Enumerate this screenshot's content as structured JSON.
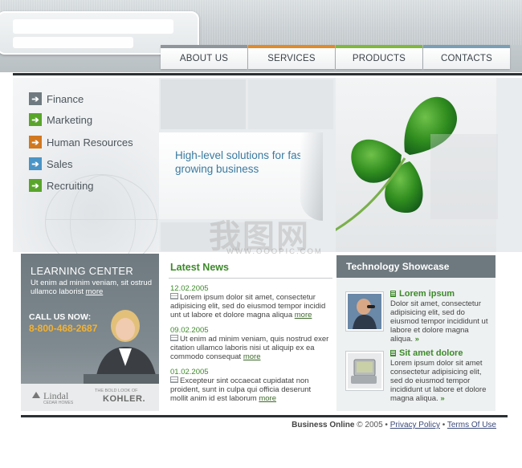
{
  "nav": {
    "tabs": [
      {
        "label": "ABOUT US"
      },
      {
        "label": "SERVICES"
      },
      {
        "label": "PRODUCTS"
      },
      {
        "label": "CONTACTS"
      }
    ]
  },
  "sidebar": {
    "items": [
      {
        "label": "Finance",
        "icon": "arrow-right-icon",
        "color": "#6e7a80"
      },
      {
        "label": "Marketing",
        "icon": "arrow-right-icon",
        "color": "#59a52b"
      },
      {
        "label": "Human Resources",
        "icon": "arrow-right-icon",
        "color": "#d2781f"
      },
      {
        "label": "Sales",
        "icon": "arrow-right-icon",
        "color": "#4a94c6"
      },
      {
        "label": "Recruiting",
        "icon": "arrow-right-icon",
        "color": "#59a52b"
      }
    ]
  },
  "banner": {
    "tagline": "High-level solutions for fast growing business"
  },
  "watermark": {
    "main": "我图网",
    "sub": "WWW.OOOPIC.COM"
  },
  "learning": {
    "title": "LEARNING CENTER",
    "text": "Ut enim ad minim veniam, sit ostrud ullamco laborist",
    "more": "more",
    "callus": "CALL US NOW:",
    "phone": "8-800-468-2687",
    "brand1": "Lindal",
    "brand1_sub": "CEDAR HOMES",
    "brand2_tag": "THE BOLD LOOK OF",
    "brand2": "KOHLER."
  },
  "news": {
    "title": "Latest News",
    "items": [
      {
        "date": "12.02.2005",
        "text": "Lorem ipsum dolor sit amet, consectetur adipisicing elit, sed do eiusmod tempor incidid unt ut labore et dolore magna aliqua",
        "more": "more"
      },
      {
        "date": "09.02.2005",
        "text": "Ut enim ad minim veniam, quis nostrud exer citation ullamco laboris nisi ut aliquip ex ea commodo consequat",
        "more": "more"
      },
      {
        "date": "01.02.2005",
        "text": "Excepteur sint occaecat cupidatat non proident, sunt in culpa qui officia deserunt mollit anim id est laborum",
        "more": "more"
      }
    ]
  },
  "tech": {
    "title": "Technology Showcase",
    "items": [
      {
        "title": "Lorem ipsum",
        "text": "Dolor sit amet, consectetur adipisicing elit, sed do eiusmod tempor incididunt ut labore et dolore magna aliqua.",
        "more": "»"
      },
      {
        "title": "Sit amet dolore",
        "text": "Lorem ipsum dolor sit amet consectetur adipisicing elit, sed do eiusmod tempor incididunt ut labore et dolore magna aliqua.",
        "more": "»"
      }
    ]
  },
  "footer": {
    "company": "Business Online",
    "copyright": "© 2005 •",
    "privacy": "Privacy Policy",
    "sep": "•",
    "terms": "Terms Of Use"
  }
}
